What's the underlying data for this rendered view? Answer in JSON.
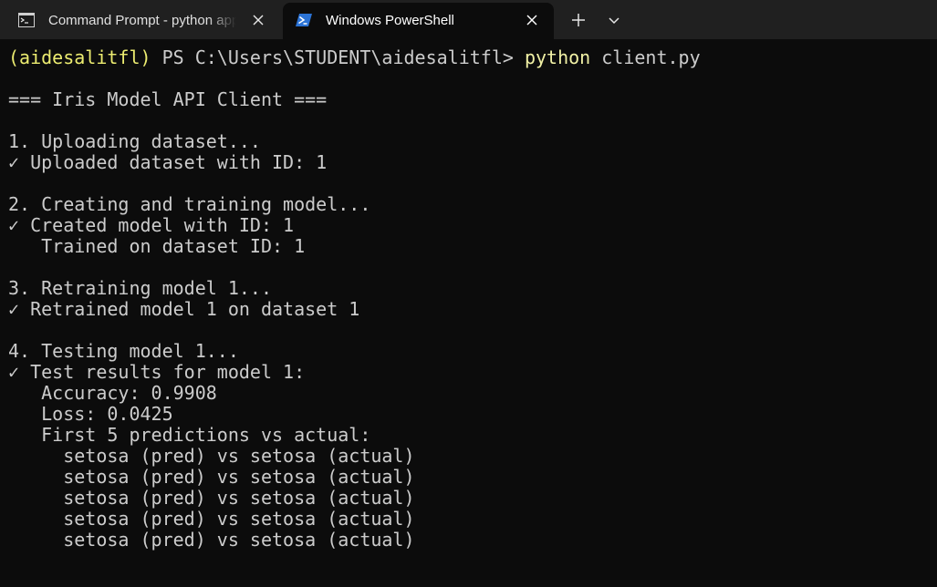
{
  "tabs": [
    {
      "title": "Command Prompt - python  app",
      "close_label": "×"
    },
    {
      "title": "Windows PowerShell",
      "close_label": "×"
    }
  ],
  "tabbar": {
    "new_tab_label": "+",
    "dropdown_label": "⌄"
  },
  "terminal": {
    "prompt_env": "(aidesalitfl)",
    "prompt_path": " PS C:\\Users\\STUDENT\\aidesalitfl> ",
    "command_name": "python",
    "command_args": " client.py",
    "lines": [
      "",
      "=== Iris Model API Client ===",
      "",
      "1. Uploading dataset...",
      "✓ Uploaded dataset with ID: 1",
      "",
      "2. Creating and training model...",
      "✓ Created model with ID: 1",
      "   Trained on dataset ID: 1",
      "",
      "3. Retraining model 1...",
      "✓ Retrained model 1 on dataset 1",
      "",
      "4. Testing model 1...",
      "✓ Test results for model 1:",
      "   Accuracy: 0.9908",
      "   Loss: 0.0425",
      "   First 5 predictions vs actual:",
      "     setosa (pred) vs setosa (actual)",
      "     setosa (pred) vs setosa (actual)",
      "     setosa (pred) vs setosa (actual)",
      "     setosa (pred) vs setosa (actual)",
      "     setosa (pred) vs setosa (actual)"
    ]
  },
  "colors": {
    "background": "#0c0c0c",
    "tabbar": "#202020",
    "text": "#cccccc",
    "prompt_env": "#ecec70",
    "command": "#f2f2a6",
    "powershell_icon": "#2b73d6"
  },
  "icons": {
    "tab_0": "command-prompt-icon",
    "tab_1": "powershell-icon",
    "close": "close-icon",
    "new_tab": "plus-icon",
    "dropdown": "chevron-down-icon"
  }
}
